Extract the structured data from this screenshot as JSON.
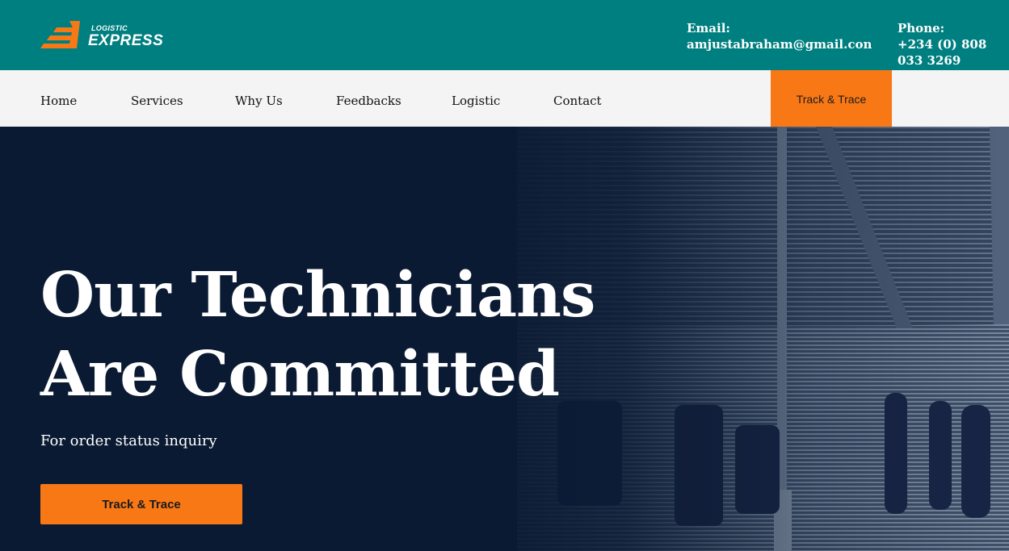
{
  "brand": {
    "tagline": "LOGISTIC",
    "name": "EXPRESS",
    "accent_color": "#f97816",
    "topbar_color": "#007f80"
  },
  "contact": {
    "email_label": "Email:",
    "email_value": "amjustabraham@gmail.con",
    "phone_label": "Phone:",
    "phone_value": "+234 (0) 808 033 3269"
  },
  "nav": {
    "items": [
      "Home",
      "Services",
      "Why Us",
      "Feedbacks",
      "Logistic",
      "Contact"
    ],
    "cta_label": "Track & Trace"
  },
  "hero": {
    "title_line1": "Our Technicians",
    "title_line2": "Are Committed",
    "subtitle": "For order status inquiry",
    "cta_label": "Track & Trace"
  }
}
